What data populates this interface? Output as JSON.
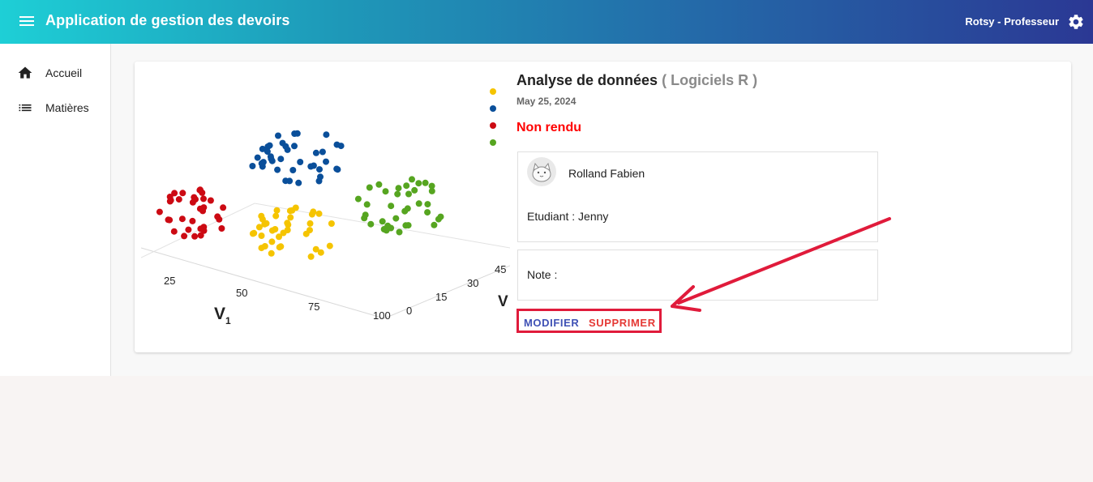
{
  "header": {
    "title": "Application de gestion des devoirs",
    "user": "Rotsy - Professeur"
  },
  "sidebar": {
    "items": [
      {
        "label": "Accueil",
        "icon": "home-icon"
      },
      {
        "label": "Matières",
        "icon": "list-icon"
      }
    ]
  },
  "assignment": {
    "title": "Analyse de données",
    "subject": "( Logiciels R )",
    "date": "May 25, 2024",
    "status": "Non rendu",
    "author": "Rolland Fabien",
    "student": "Etudiant : Jenny",
    "note": "Note :",
    "edit_label": "MODIFIER",
    "delete_label": "SUPPRIMER"
  },
  "image_axes": {
    "x_ticks": [
      "25",
      "50",
      "75",
      "100"
    ],
    "x_label": "V",
    "x_label_sub": "1",
    "y_ticks": [
      "0",
      "15",
      "30",
      "45"
    ],
    "y_label": "V"
  },
  "colors": {
    "status": "#ff0000",
    "edit": "#3f51b5",
    "delete": "#e53935",
    "highlight": "#e01b3b",
    "cluster_colors": [
      "#f5c400",
      "#0a4f9a",
      "#cc0a13",
      "#56a520"
    ]
  }
}
